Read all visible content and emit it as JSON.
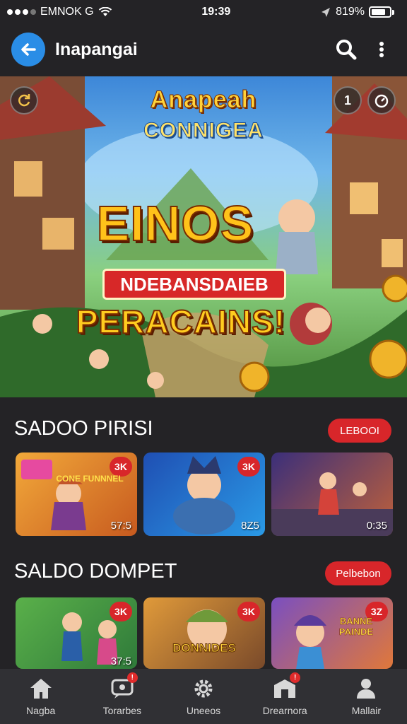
{
  "status_bar": {
    "carrier": "EMNOK G",
    "time": "19:39",
    "battery": "819%"
  },
  "header": {
    "title": "Inapangai",
    "back_icon": "arrow-left-icon",
    "search_icon": "search-icon",
    "menu_icon": "more-vertical-icon"
  },
  "banner": {
    "title_line1": "Anapeah",
    "title_line2": "CONNIGEA",
    "big_text": "EINOS",
    "ribbon_text": "NDEBANSDAIEB",
    "bottom_text": "PERACAINS!",
    "left_badge_icon": "refresh-icon",
    "right_badge_text": "1",
    "right_icon": "timer-icon"
  },
  "sections": [
    {
      "title": "SADOO PIRISI",
      "button": "LEBOOI",
      "cards": [
        {
          "tag": "3K",
          "time": "57:5",
          "caption": "CONE FUNNNEL"
        },
        {
          "tag": "3K",
          "time": "8Z5",
          "caption": ""
        },
        {
          "tag": "",
          "time": "0:35",
          "caption": ""
        }
      ]
    },
    {
      "title": "SALDO DOMPET",
      "button": "Pelbebon",
      "cards": [
        {
          "tag": "3K",
          "time": "37:5",
          "caption": ""
        },
        {
          "tag": "3K",
          "time": "",
          "caption": "DONNIDES"
        },
        {
          "tag": "3Z",
          "time": "",
          "caption": "BANNE PAINDE"
        }
      ]
    }
  ],
  "nav": [
    {
      "label": "Nagba",
      "icon": "home-icon",
      "badge": ""
    },
    {
      "label": "Torarbes",
      "icon": "chat-icon",
      "badge": "!"
    },
    {
      "label": "Uneeos",
      "icon": "gear-icon",
      "badge": ""
    },
    {
      "label": "Drearnora",
      "icon": "store-icon",
      "badge": "!"
    },
    {
      "label": "Mallair",
      "icon": "profile-icon",
      "badge": ""
    }
  ],
  "colors": {
    "background": "#242326",
    "accent_red": "#d8262a",
    "back_button_blue": "#2a8de6",
    "nav_background": "#303034"
  }
}
